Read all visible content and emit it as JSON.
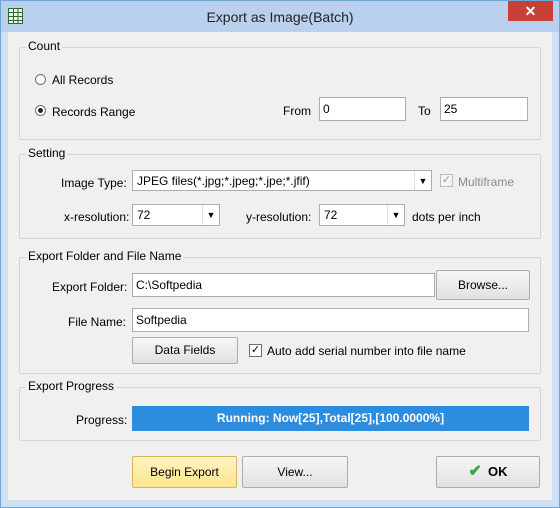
{
  "window": {
    "title": "Export as Image(Batch)",
    "close_glyph": "✕",
    "icon": "spreadsheet-icon"
  },
  "count": {
    "legend": "Count",
    "all_records_label": "All Records",
    "records_range_label": "Records Range",
    "selected": "records-range",
    "from_label": "From",
    "from_value": "0",
    "to_label": "To",
    "to_value": "25"
  },
  "setting": {
    "legend": "Setting",
    "image_type_label": "Image Type:",
    "image_type_value": "JPEG files(*.jpg;*.jpeg;*.jpe;*.jfif)",
    "multiframe_label": "Multiframe",
    "multiframe_checked": true,
    "multiframe_enabled": false,
    "x_resolution_label": "x-resolution:",
    "x_resolution_value": "72",
    "y_resolution_label": "y-resolution:",
    "y_resolution_value": "72",
    "dpi_label": "dots per inch"
  },
  "export_folder": {
    "legend": "Export Folder and File Name",
    "folder_label": "Export Folder:",
    "folder_value": "C:\\Softpedia",
    "browse_label": "Browse...",
    "file_name_label": "File Name:",
    "file_name_value": "Softpedia",
    "data_fields_label": "Data Fields",
    "auto_serial_label": "Auto add serial number into file name",
    "auto_serial_checked": true
  },
  "progress": {
    "legend": "Export Progress",
    "label": "Progress:",
    "status_text": "Running: Now[25],Total[25],[100.0000%]",
    "percent": 100,
    "bar_color": "#2b8ce0"
  },
  "footer": {
    "begin_export_label": "Begin Export",
    "view_label": "View...",
    "ok_label": "OK",
    "ok_icon": "checkmark-icon"
  },
  "colors": {
    "titlebar": "#b9d1ee",
    "close_button": "#c7413a",
    "primary_button": "#fde68b"
  }
}
